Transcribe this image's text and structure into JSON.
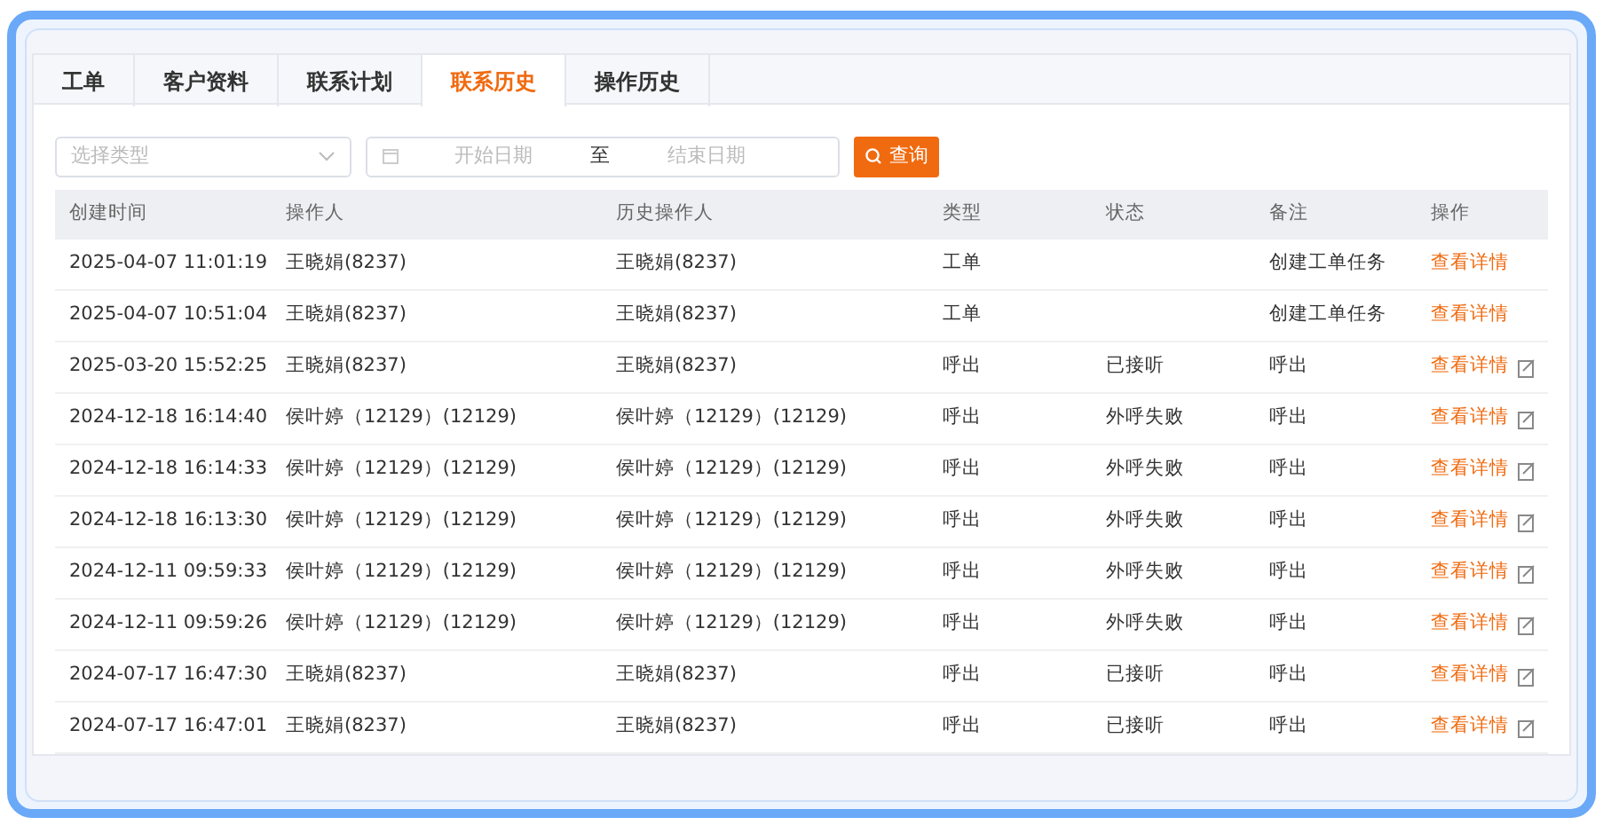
{
  "tabs": [
    {
      "label": "工单",
      "selected": false
    },
    {
      "label": "客户资料",
      "selected": false
    },
    {
      "label": "联系计划",
      "selected": false
    },
    {
      "label": "联系历史",
      "selected": true
    },
    {
      "label": "操作历史",
      "selected": false
    }
  ],
  "filters": {
    "type_select": {
      "placeholder": "选择类型"
    },
    "start_date": {
      "placeholder": "开始日期"
    },
    "separator": "至",
    "end_date": {
      "placeholder": "结束日期"
    },
    "query_button": "查询"
  },
  "table": {
    "columns": [
      "创建时间",
      "操作人",
      "历史操作人",
      "类型",
      "状态",
      "备注",
      "操作"
    ],
    "rows": [
      {
        "time": "2025-04-07 11:01:19",
        "operator": "王晓娟(8237)",
        "history_operator": "王晓娟(8237)",
        "type": "工单",
        "note": "创建工单任务",
        "action": "查看详情",
        "edit_icon": false
      },
      {
        "time": "2025-04-07 10:51:04",
        "operator": "王晓娟(8237)",
        "history_operator": "王晓娟(8237)",
        "type": "工单",
        "note": "创建工单任务",
        "action": "查看详情",
        "edit_icon": false
      },
      {
        "time": "2025-03-20 15:52:25",
        "operator": "王晓娟(8237)",
        "history_operator": "王晓娟(8237)",
        "type": "呼出",
        "status": "已接听",
        "note": "呼出",
        "action": "查看详情",
        "edit_icon": true
      },
      {
        "time": "2024-12-18 16:14:40",
        "operator": "侯叶婷（12129）(12129)",
        "history_operator": "侯叶婷（12129）(12129)",
        "type": "呼出",
        "status": "外呼失败",
        "note": "呼出",
        "action": "查看详情",
        "edit_icon": true
      },
      {
        "time": "2024-12-18 16:14:33",
        "operator": "侯叶婷（12129）(12129)",
        "history_operator": "侯叶婷（12129）(12129)",
        "type": "呼出",
        "status": "外呼失败",
        "note": "呼出",
        "action": "查看详情",
        "edit_icon": true
      },
      {
        "time": "2024-12-18 16:13:30",
        "operator": "侯叶婷（12129）(12129)",
        "history_operator": "侯叶婷（12129）(12129)",
        "type": "呼出",
        "status": "外呼失败",
        "note": "呼出",
        "action": "查看详情",
        "edit_icon": true
      },
      {
        "time": "2024-12-11 09:59:33",
        "operator": "侯叶婷（12129）(12129)",
        "history_operator": "侯叶婷（12129）(12129)",
        "type": "呼出",
        "status": "外呼失败",
        "note": "呼出",
        "action": "查看详情",
        "edit_icon": true
      },
      {
        "time": "2024-12-11 09:59:26",
        "operator": "侯叶婷（12129）(12129)",
        "history_operator": "侯叶婷（12129）(12129)",
        "type": "呼出",
        "status": "外呼失败",
        "note": "呼出",
        "action": "查看详情",
        "edit_icon": true
      },
      {
        "time": "2024-07-17 16:47:30",
        "operator": "王晓娟(8237)",
        "history_operator": "王晓娟(8237)",
        "type": "呼出",
        "status": "已接听",
        "note": "呼出",
        "action": "查看详情",
        "edit_icon": true
      },
      {
        "time": "2024-07-17 16:47:01",
        "operator": "王晓娟(8237)",
        "history_operator": "王晓娟(8237)",
        "type": "呼出",
        "status": "已接听",
        "note": "呼出",
        "action": "查看详情",
        "edit_icon": true
      }
    ]
  }
}
